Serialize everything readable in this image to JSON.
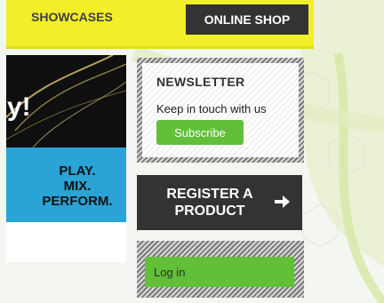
{
  "nav": {
    "showcases_label": "SHOWCASES",
    "shop_label": "ONLINE SHOP"
  },
  "hero": {
    "headline_fragment": "y!",
    "tagline_1": "PLAY.",
    "tagline_2": "MIX.",
    "tagline_3": "PERFORM."
  },
  "newsletter": {
    "title": "NEWSLETTER",
    "text": "Keep in touch with us",
    "button_label": "Subscribe"
  },
  "register": {
    "line_1": "REGISTER A",
    "line_2": "PRODUCT",
    "icon": "arrow-right-icon"
  },
  "login": {
    "button_label": "Log in"
  },
  "colors": {
    "yellow": "#f2ee2a",
    "dark": "#333333",
    "green": "#62bf3a",
    "blue": "#2aa3d6"
  }
}
